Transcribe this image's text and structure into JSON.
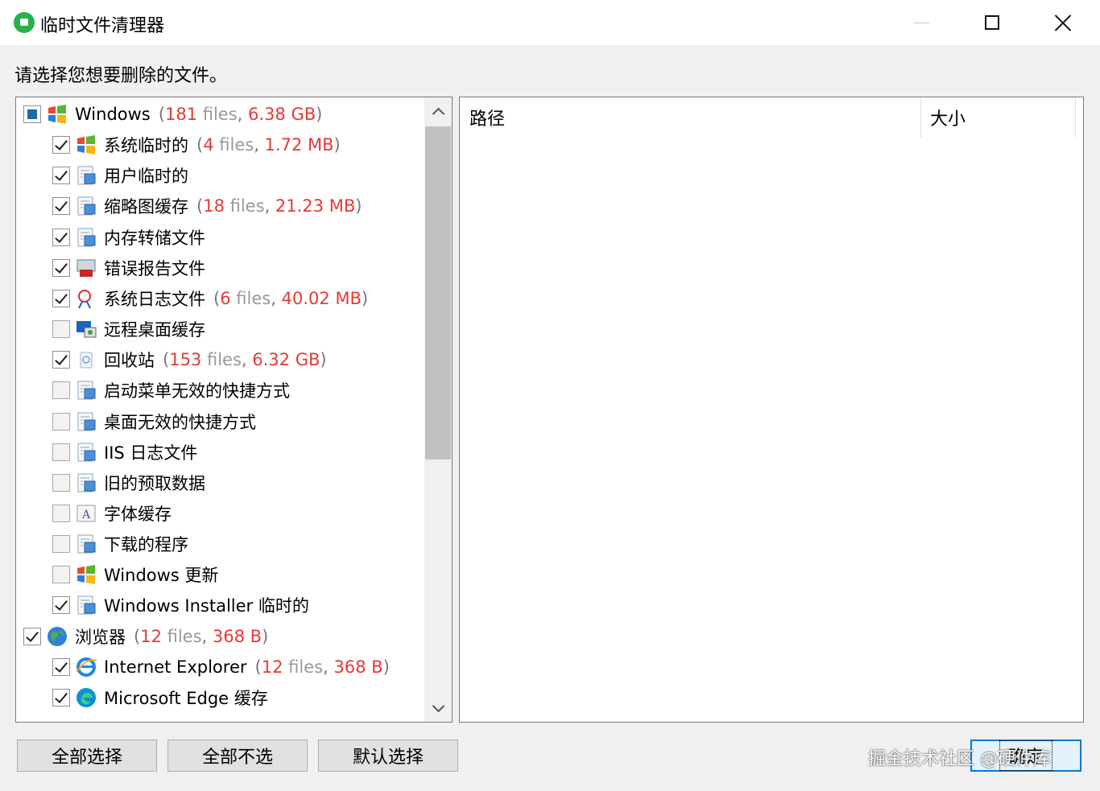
{
  "window": {
    "title": "临时文件清理器"
  },
  "instruction": "请选择您想要删除的文件。",
  "tree": {
    "items": [
      {
        "label": "Windows",
        "state": "partial",
        "level": 0,
        "icon": "windows-flag-icon",
        "files": "181",
        "size": "6.38 GB"
      },
      {
        "label": "系统临时的",
        "state": "checked",
        "level": 1,
        "icon": "windows-flag-icon",
        "files": "4",
        "size": "1.72 MB"
      },
      {
        "label": "用户临时的",
        "state": "checked",
        "level": 1,
        "icon": "user-files-icon"
      },
      {
        "label": "缩略图缓存",
        "state": "checked",
        "level": 1,
        "icon": "thumbnail-cache-icon",
        "files": "18",
        "size": "21.23 MB"
      },
      {
        "label": "内存转储文件",
        "state": "checked",
        "level": 1,
        "icon": "memory-dump-icon"
      },
      {
        "label": "错误报告文件",
        "state": "checked",
        "level": 1,
        "icon": "error-report-icon"
      },
      {
        "label": "系统日志文件",
        "state": "checked",
        "level": 1,
        "icon": "system-log-icon",
        "files": "6",
        "size": "40.02 MB"
      },
      {
        "label": "远程桌面缓存",
        "state": "unchecked",
        "level": 1,
        "icon": "remote-desktop-icon"
      },
      {
        "label": "回收站",
        "state": "checked",
        "level": 1,
        "icon": "recycle-bin-icon",
        "files": "153",
        "size": "6.32 GB"
      },
      {
        "label": "启动菜单无效的快捷方式",
        "state": "unchecked",
        "level": 1,
        "icon": "start-menu-shortcut-icon"
      },
      {
        "label": "桌面无效的快捷方式",
        "state": "unchecked",
        "level": 1,
        "icon": "desktop-shortcut-icon"
      },
      {
        "label": "IIS 日志文件",
        "state": "unchecked",
        "level": 1,
        "icon": "iis-log-icon"
      },
      {
        "label": "旧的预取数据",
        "state": "unchecked",
        "level": 1,
        "icon": "prefetch-icon"
      },
      {
        "label": "字体缓存",
        "state": "unchecked",
        "level": 1,
        "icon": "font-cache-icon"
      },
      {
        "label": "下载的程序",
        "state": "unchecked",
        "level": 1,
        "icon": "downloaded-programs-icon"
      },
      {
        "label": "Windows 更新",
        "state": "unchecked",
        "level": 1,
        "icon": "windows-update-icon"
      },
      {
        "label": "Windows Installer 临时的",
        "state": "checked",
        "level": 1,
        "icon": "installer-icon"
      },
      {
        "label": "浏览器",
        "state": "checked",
        "level": 0,
        "icon": "globe-icon",
        "files": "12",
        "size": "368 B"
      },
      {
        "label": "Internet Explorer",
        "state": "checked",
        "level": 1,
        "icon": "internet-explorer-icon",
        "files": "12",
        "size": "368 B"
      },
      {
        "label": "Microsoft Edge 缓存",
        "state": "checked",
        "level": 1,
        "icon": "edge-icon"
      }
    ],
    "files_word": "files",
    "scroll_fraction": 0.54
  },
  "detail": {
    "columns": [
      "路径",
      "大小"
    ]
  },
  "buttons": {
    "select_all": "全部选择",
    "select_none": "全部不选",
    "default_select": "默认选择",
    "confirm": "确定"
  },
  "watermark": "掘金技术社区 @硬件库",
  "colors": {
    "stats_red": "#e53935",
    "accent_blue": "#0078d7",
    "app_green": "#26b14b"
  }
}
